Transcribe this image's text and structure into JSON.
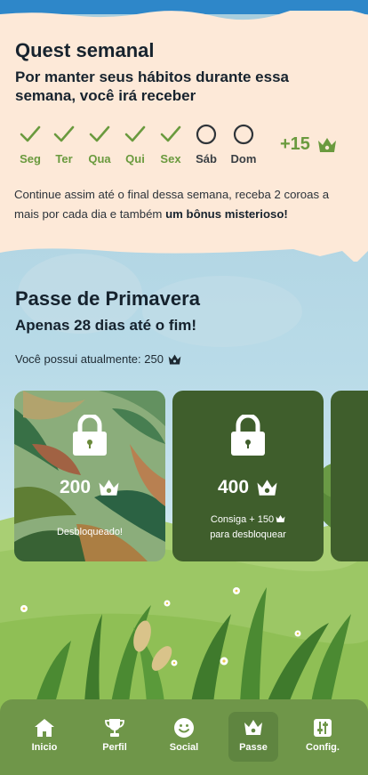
{
  "quest": {
    "title": "Quest semanal",
    "subtitle": "Por manter seus hábitos durante essa semana, você irá receber",
    "days": [
      {
        "label": "Seg",
        "done": true
      },
      {
        "label": "Ter",
        "done": true
      },
      {
        "label": "Qua",
        "done": true
      },
      {
        "label": "Qui",
        "done": true
      },
      {
        "label": "Sex",
        "done": true
      },
      {
        "label": "Sáb",
        "done": false
      },
      {
        "label": "Dom",
        "done": false
      }
    ],
    "reward": "+15",
    "description": "Continue assim até o final dessa semana, receba 2 coroas a mais por cada dia e também ",
    "description_bold": "um bônus misterioso!"
  },
  "pass": {
    "title": "Passe de Primavera",
    "subtitle": "Apenas 28 dias até o fim!",
    "balance_label": "Você possui atualmente: 250",
    "cards": [
      {
        "points": "200",
        "status": "Desbloqueado!"
      },
      {
        "points": "400",
        "need_line1": "Consiga + 150",
        "need_line2": "para desbloquear"
      }
    ]
  },
  "nav": {
    "items": [
      {
        "label": "Inicio",
        "icon": "home-icon"
      },
      {
        "label": "Perfil",
        "icon": "trophy-icon"
      },
      {
        "label": "Social",
        "icon": "smiley-icon"
      },
      {
        "label": "Passe",
        "icon": "crown-icon",
        "active": true
      },
      {
        "label": "Config.",
        "icon": "sliders-icon"
      }
    ]
  },
  "colors": {
    "accent_green": "#6a9a3e",
    "nav_green": "#6f9649",
    "card_dark_green": "#3f5e2c",
    "parchment": "#fde9d8",
    "top_band": "#2e87c9"
  }
}
